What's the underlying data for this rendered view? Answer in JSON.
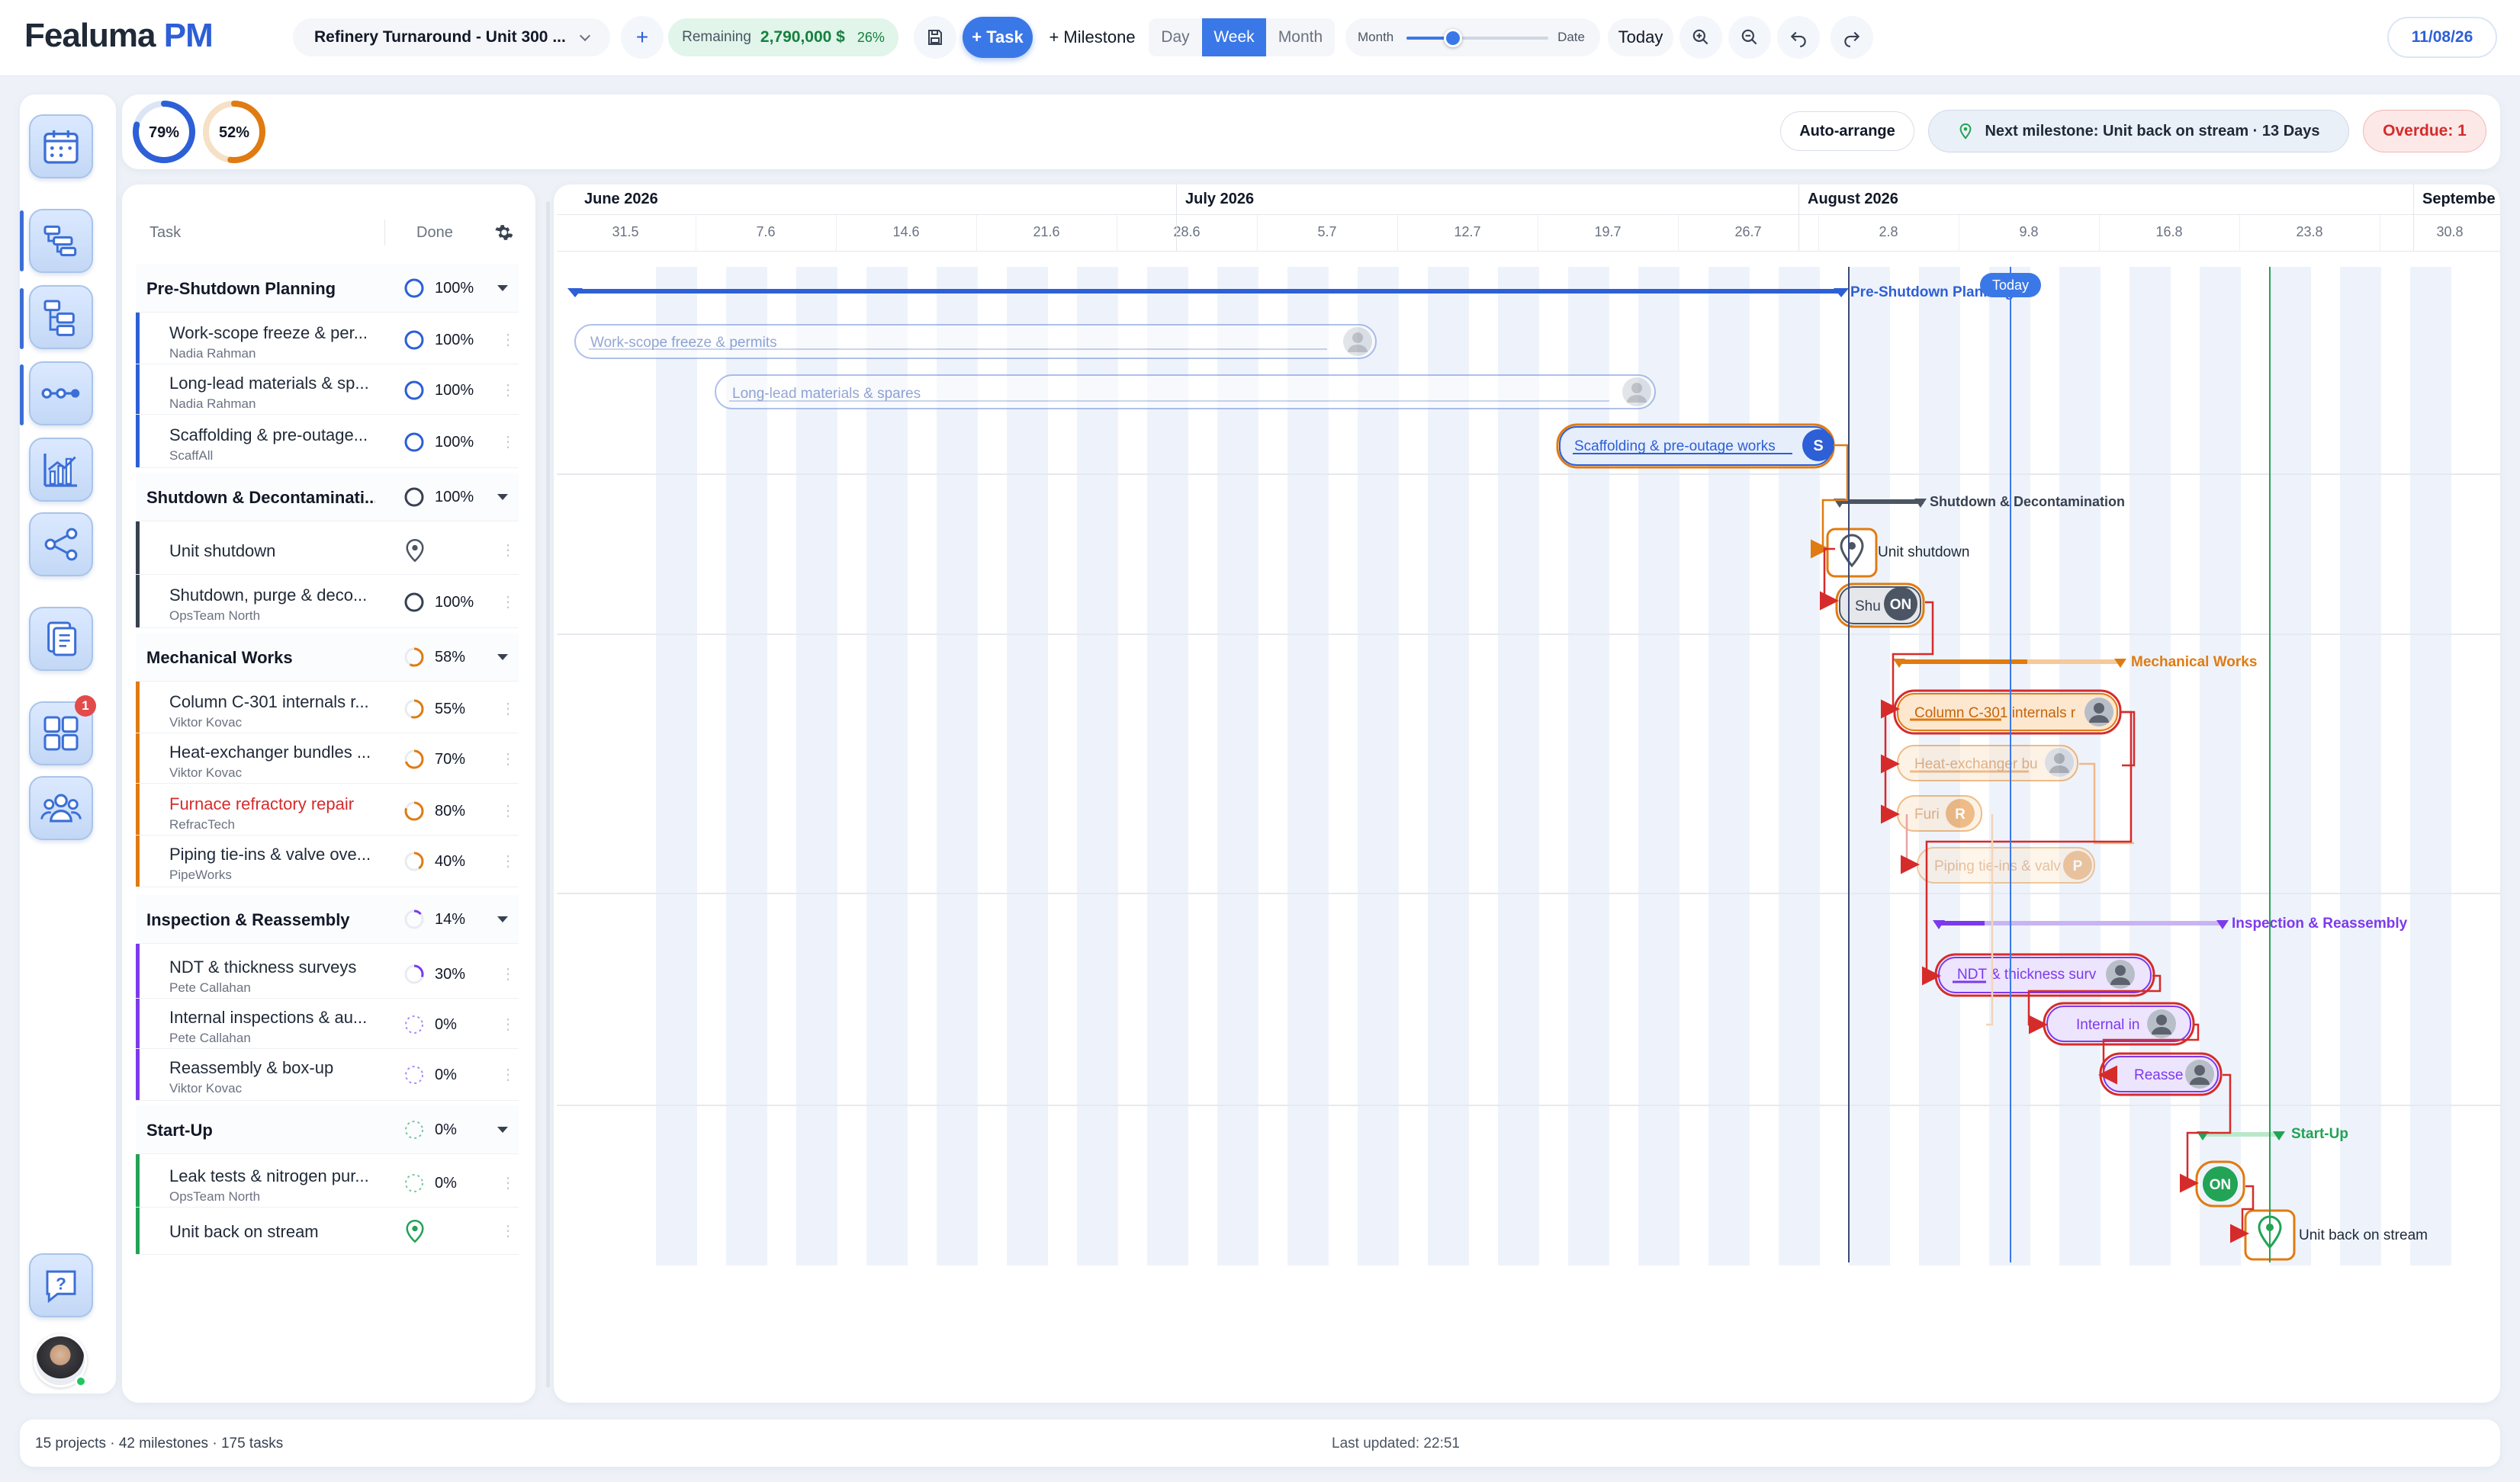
{
  "app": {
    "logo_main": "Fealuma",
    "logo_accent": "PM"
  },
  "toolbar": {
    "project_name": "Refinery Turnaround - Unit 300 ...",
    "remaining_label": "Remaining",
    "remaining_value": "2,790,000 $",
    "remaining_pct": "26%",
    "add_task": "+ Task",
    "add_milestone": "+ Milestone",
    "view_day": "Day",
    "view_week": "Week",
    "view_month": "Month",
    "zoom_left": "Month",
    "zoom_right": "Date",
    "zoom_level": 0.33,
    "today": "Today",
    "date": "11/08/26"
  },
  "summary": {
    "ring1": "79%",
    "ring1_value": 0.79,
    "ring2": "52%",
    "ring2_value": 0.52,
    "auto_arrange": "Auto-arrange",
    "next_milestone": "Next milestone: Unit back on stream · 13 Days",
    "overdue": "Overdue: 1"
  },
  "nav": {
    "badge": "1"
  },
  "tasklist": {
    "col_task": "Task",
    "col_done": "Done",
    "rows": [
      {
        "name": "Pre-Shutdown Planning",
        "pct": "100%",
        "group": true,
        "color": "#2d5fd6",
        "value": 1.0
      },
      {
        "name": "Work-scope freeze & per...",
        "sub": "Nadia Rahman",
        "pct": "100%",
        "color": "#2d5fd6",
        "value": 1.0
      },
      {
        "name": "Long-lead materials & sp...",
        "sub": "Nadia Rahman",
        "pct": "100%",
        "color": "#2d5fd6",
        "value": 1.0
      },
      {
        "name": "Scaffolding & pre-outage...",
        "sub": "ScaffAll",
        "pct": "100%",
        "color": "#2d5fd6",
        "value": 1.0
      },
      {
        "name": "Shutdown & Decontaminati...",
        "pct": "100%",
        "group": true,
        "color": "#374151",
        "value": 1.0
      },
      {
        "name": "Unit shutdown",
        "milestone": true,
        "color": "#4b5563"
      },
      {
        "name": "Shutdown, purge & deco...",
        "sub": "OpsTeam North",
        "pct": "100%",
        "color": "#374151",
        "value": 1.0
      },
      {
        "name": "Mechanical Works",
        "pct": "58%",
        "group": true,
        "color": "#e07b12",
        "value": 0.58
      },
      {
        "name": "Column C-301 internals r...",
        "sub": "Viktor Kovac",
        "pct": "55%",
        "color": "#e07b12",
        "value": 0.55
      },
      {
        "name": "Heat-exchanger bundles ...",
        "sub": "Viktor Kovac",
        "pct": "70%",
        "color": "#e07b12",
        "value": 0.7
      },
      {
        "name": "Furnace refractory repair",
        "sub": "RefracTech",
        "pct": "80%",
        "color": "#e07b12",
        "value": 0.8,
        "overdue": true
      },
      {
        "name": "Piping tie-ins & valve ove...",
        "sub": "PipeWorks",
        "pct": "40%",
        "color": "#e07b12",
        "value": 0.4
      },
      {
        "name": "Inspection & Reassembly",
        "pct": "14%",
        "group": true,
        "color": "#7c3aed",
        "value": 0.14
      },
      {
        "name": "NDT & thickness surveys",
        "sub": "Pete Callahan",
        "pct": "30%",
        "color": "#7c3aed",
        "value": 0.3
      },
      {
        "name": "Internal inspections & au...",
        "sub": "Pete Callahan",
        "pct": "0%",
        "color": "#7c3aed",
        "value": 0.0
      },
      {
        "name": "Reassembly & box-up",
        "sub": "Viktor Kovac",
        "pct": "0%",
        "color": "#7c3aed",
        "value": 0.0
      },
      {
        "name": "Start-Up",
        "pct": "0%",
        "group": true,
        "color": "#22a355",
        "value": 0.0
      },
      {
        "name": "Leak tests & nitrogen pur...",
        "sub": "OpsTeam North",
        "pct": "0%",
        "color": "#22a355",
        "value": 0.0
      },
      {
        "name": "Unit back on stream",
        "milestone": true,
        "color": "#22a355"
      }
    ]
  },
  "gantt": {
    "months": [
      "June 2026",
      "July 2026",
      "August 2026",
      "September"
    ],
    "weeks": [
      "31.5",
      "7.6",
      "14.6",
      "21.6",
      "28.6",
      "5.7",
      "12.7",
      "19.7",
      "26.7",
      "2.8",
      "9.8",
      "16.8",
      "23.8",
      "30.8"
    ],
    "today_label": "Today",
    "group_labels": {
      "pre": "Pre-Shutdown Planning",
      "shut": "Shutdown & Decontamination",
      "mech": "Mechanical Works",
      "insp": "Inspection & Reassembly",
      "start": "Start-Up"
    },
    "bars": {
      "b1": "Work-scope freeze & permits",
      "b2": "Long-lead materials & spares",
      "b3": "Scaffolding & pre-outage works",
      "b3_badge": "S",
      "m1": "Unit shutdown",
      "b4": "Shu",
      "b4_badge": "ON",
      "b5": "Column C-301 internals r",
      "b6": "Heat-exchanger bu",
      "b7": "Furi",
      "b7_badge": "R",
      "b8": "Piping tie-ins & valv",
      "b8_badge": "P",
      "b9": "NDT & thickness surv",
      "b10": "Internal in",
      "b11": "Reasse",
      "b12_badge": "ON",
      "m2": "Unit back on stream"
    }
  },
  "status": {
    "left": "15 projects · 42 milestones · 175 tasks",
    "center": "Last updated: 22:51"
  }
}
